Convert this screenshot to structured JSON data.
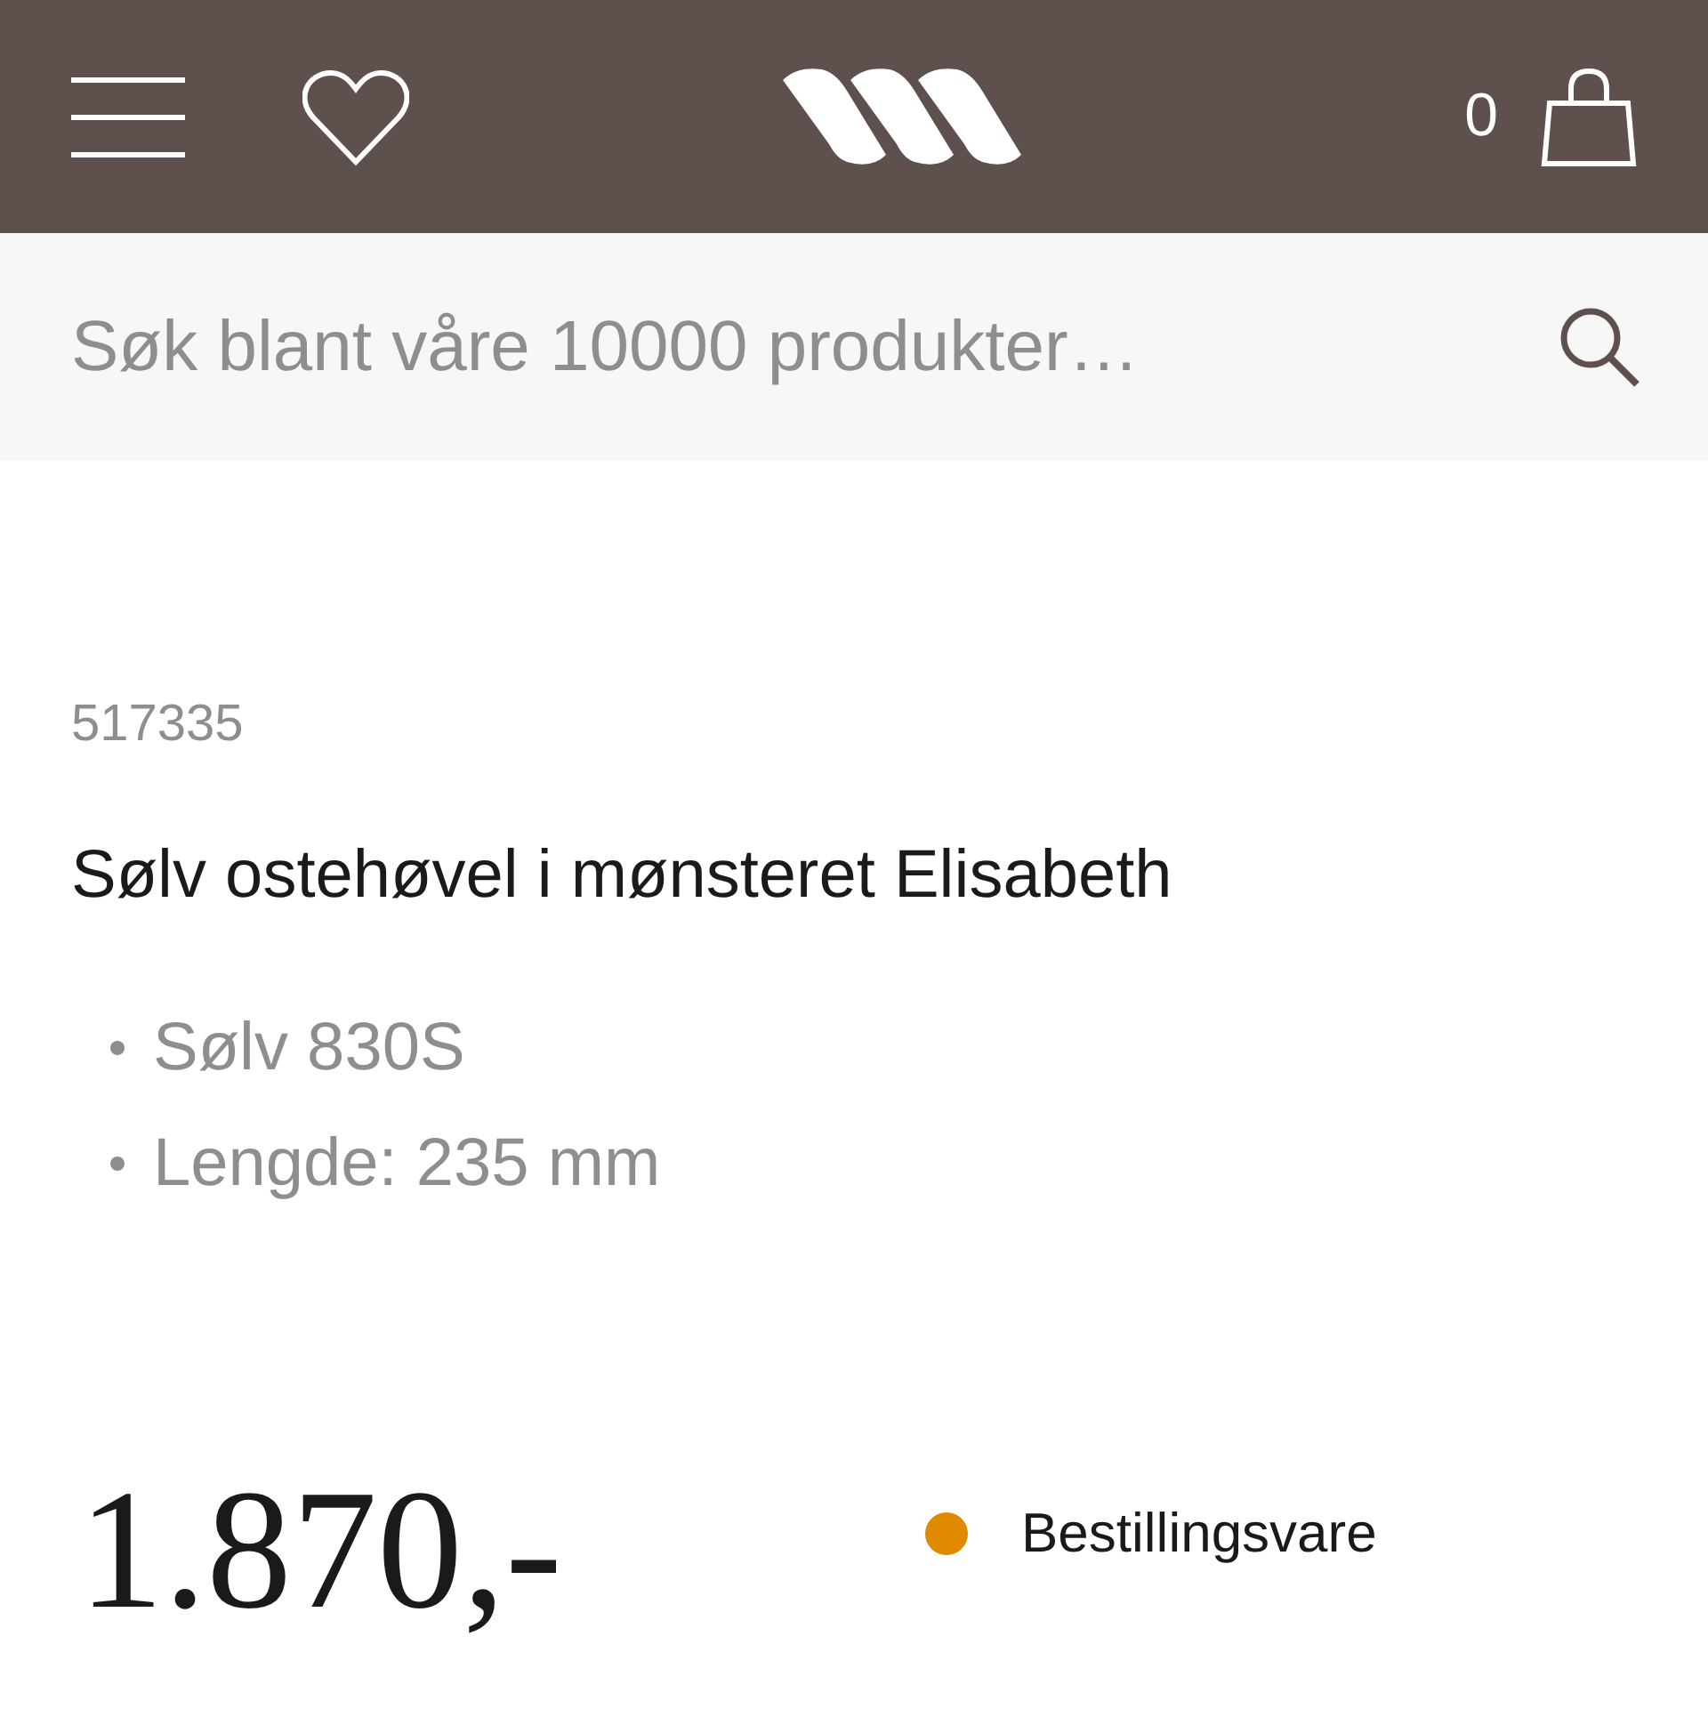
{
  "header": {
    "cart_count": "0"
  },
  "search": {
    "placeholder": "Søk blant våre 10000 produkter…"
  },
  "product": {
    "sku": "517335",
    "title": "Sølv ostehøvel i mønsteret Elisabeth",
    "features": [
      "Sølv 830S",
      "Lengde: 235 mm"
    ],
    "price": "1.870,-",
    "availability": {
      "label": "Bestillingsvare",
      "color": "#e08a00"
    }
  }
}
